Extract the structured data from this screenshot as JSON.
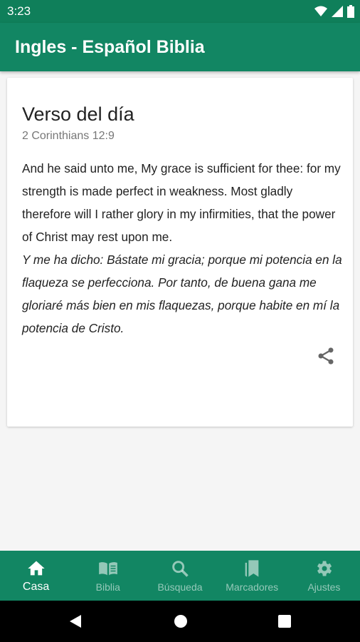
{
  "status_bar": {
    "time": "3:23",
    "icons": [
      "wifi-icon",
      "signal-icon",
      "battery-icon"
    ]
  },
  "app_bar": {
    "title": "Ingles - Español Biblia",
    "color": "#128663"
  },
  "verse_card": {
    "title": "Verso del día",
    "reference": "2 Corinthians 12:9",
    "text_en": "And he said unto me, My grace is sufficient for thee: for my strength is made perfect in weakness. Most gladly therefore will I rather glory in my infirmities, that the power of Christ may rest upon me.",
    "text_es": "Y me ha dicho: Bástate mi gracia; porque mi potencia en la flaqueza se perfecciona. Por tanto, de buena gana me gloriaré más bien en mis flaquezas, porque habite en mí la potencia de Cristo.",
    "share_icon": "share-icon"
  },
  "bottom_nav": {
    "items": [
      {
        "label": "Casa",
        "icon": "home-icon",
        "active": true
      },
      {
        "label": "Biblia",
        "icon": "book-icon",
        "active": false
      },
      {
        "label": "Búsqueda",
        "icon": "search-icon",
        "active": false
      },
      {
        "label": "Marcadores",
        "icon": "bookmarks-icon",
        "active": false
      },
      {
        "label": "Ajustes",
        "icon": "gear-icon",
        "active": false
      }
    ]
  },
  "system_nav": {
    "icons": [
      "back-icon",
      "home-circle-icon",
      "recents-icon"
    ]
  }
}
